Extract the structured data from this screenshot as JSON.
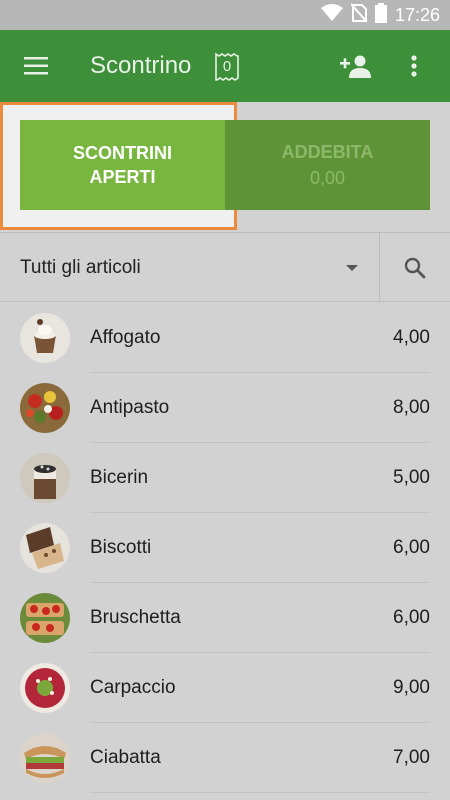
{
  "status_bar": {
    "time": "17:26",
    "icons": [
      "wifi-icon",
      "no-sim-icon",
      "battery-icon"
    ]
  },
  "app_bar": {
    "title": "Scontrino",
    "ticket_count": "0",
    "icons": [
      "menu-icon",
      "ticket-icon",
      "add-customer-icon",
      "more-vert-icon"
    ],
    "color": "#3d8f3a"
  },
  "actions": {
    "open_tickets_line1": "SCONTRINI",
    "open_tickets_line2": "APERTI",
    "charge_label": "ADDEBITA",
    "charge_amount": "0,00"
  },
  "filter": {
    "category": "Tutti gli articoli",
    "icons": [
      "dropdown-arrow-icon",
      "search-icon"
    ]
  },
  "items": [
    {
      "name": "Affogato",
      "price": "4,00"
    },
    {
      "name": "Antipasto",
      "price": "8,00"
    },
    {
      "name": "Bicerin",
      "price": "5,00"
    },
    {
      "name": "Biscotti",
      "price": "6,00"
    },
    {
      "name": "Bruschetta",
      "price": "6,00"
    },
    {
      "name": "Carpaccio",
      "price": "9,00"
    },
    {
      "name": "Ciabatta",
      "price": "7,00"
    }
  ],
  "colors": {
    "accent_green": "#78b640",
    "highlight_orange": "#e98a3c"
  }
}
